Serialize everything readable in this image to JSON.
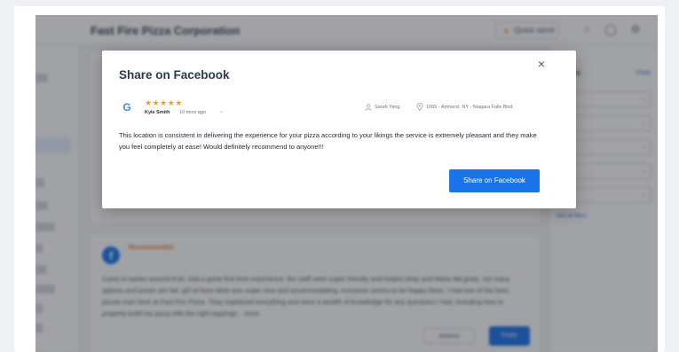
{
  "app": {
    "brand": "Fast Fire Pizza Corporation",
    "quick_send": "Quick send",
    "nav_items": [
      "",
      "",
      "",
      "",
      "",
      "",
      "",
      "",
      "",
      "",
      "",
      ""
    ],
    "filters": {
      "title": "Filter by",
      "clear": "Clear",
      "selects": [
        "",
        "",
        "",
        "",
        ""
      ],
      "see_all": "See all filters"
    },
    "background_review": {
      "recommendation": "Recommended",
      "reviewer": "",
      "meta": "",
      "text": "Came in earlier around 8:00, had a great first time experience. the staff were super friendly and helpful shop and Maria did great, not many options and prices are fair. girl at front desk was super nice and accommodating, everyone seems to be happy there. I had one of the best, pizzas ever here at Fast Fire Pizza. They explained everything and were a wealth of knowledge for any questions I had, including how to properly build my pizza with the right toppings... more",
      "actions_label": "Actions",
      "reply_label": "Reply"
    }
  },
  "modal": {
    "title": "Share on Facebook",
    "close_glyph": "×",
    "rating_stars": "★★★★★",
    "rating": 5,
    "reviewer": "Kyle Smith",
    "reviewed_ago": "10 mins ago",
    "agent": "Sarah Yang",
    "location": "1065 - Amherst, NY - Niagara Falls Blvd.",
    "review_text": "This location is consistent in delivering the experience for your pizza according to your likings the service is extremely pleasant and they make you feel completely at ease! Would definitely recommend to anyone!!!",
    "share_button": "Share on Facebook"
  },
  "colors": {
    "primary": "#1a73e8",
    "star": "#f59e0b",
    "facebook": "#1877f2",
    "recommended": "#e67e22"
  }
}
